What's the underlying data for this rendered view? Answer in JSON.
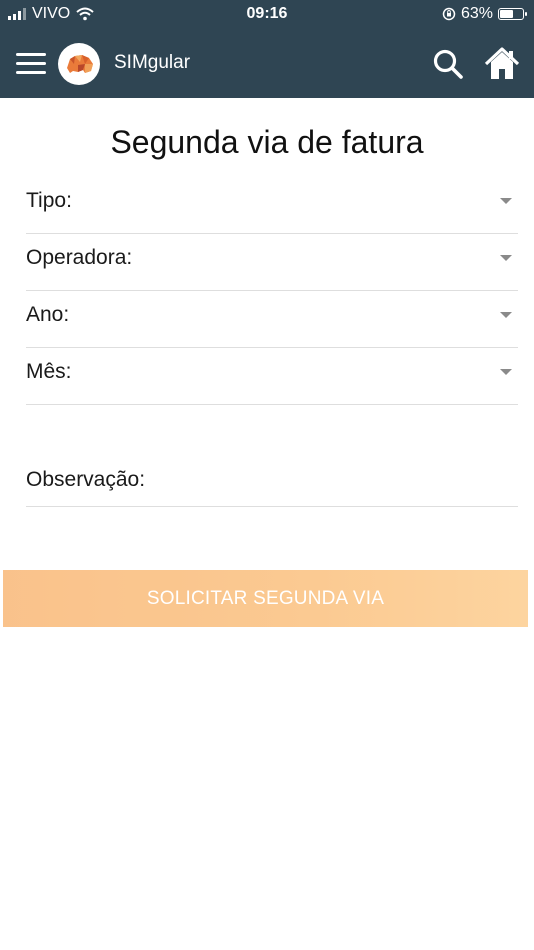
{
  "status_bar": {
    "carrier": "VIVO",
    "time": "09:16",
    "battery_percent_label": "63%",
    "battery_level": 0.63
  },
  "app_bar": {
    "title": "SIMgular",
    "menu_icon": "hamburger-menu-icon",
    "logo_icon": "bear-logo-icon",
    "search_icon": "search-icon",
    "home_icon": "home-icon"
  },
  "page": {
    "title": "Segunda via de fatura",
    "fields": [
      {
        "label": "Tipo:"
      },
      {
        "label": "Operadora:"
      },
      {
        "label": "Ano:"
      },
      {
        "label": "Mês:"
      }
    ],
    "observation_label": "Observação:",
    "submit_label": "SOLICITAR SEGUNDA VIA"
  },
  "colors": {
    "header_bg": "#2f4553",
    "button_bg": "#fbc88d",
    "button_text": "#ffffff",
    "divider": "#dedede"
  }
}
